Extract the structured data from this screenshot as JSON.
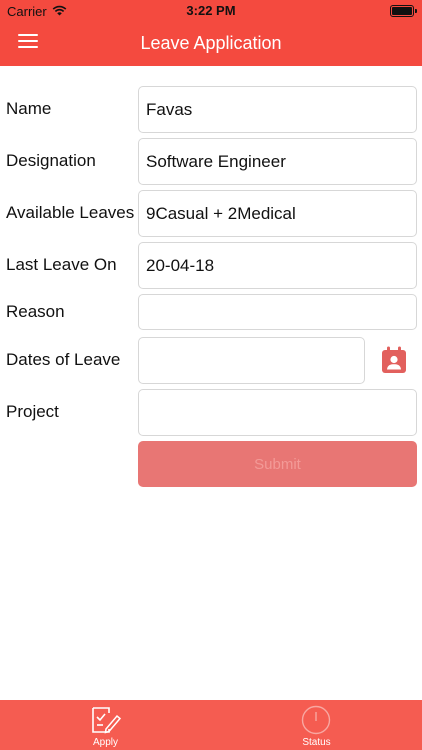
{
  "status_bar": {
    "carrier": "Carrier",
    "time": "3:22 PM"
  },
  "header": {
    "title": "Leave Application",
    "menu_icon": "hamburger-menu-icon"
  },
  "form": {
    "name": {
      "label": "Name",
      "value": "Favas"
    },
    "designation": {
      "label": "Designation",
      "value": "Software Engineer"
    },
    "available_leaves": {
      "label": "Available Leaves",
      "value": "9Casual + 2Medical"
    },
    "last_leave_on": {
      "label": "Last Leave On",
      "value": "20-04-18"
    },
    "reason": {
      "label": "Reason",
      "value": ""
    },
    "dates_of_leave": {
      "label": "Dates of Leave",
      "value": "",
      "icon": "calendar-person-icon"
    },
    "project": {
      "label": "Project",
      "value": ""
    },
    "submit_label": "Submit"
  },
  "tabbar": {
    "tabs": [
      {
        "label": "Apply",
        "icon": "apply-form-icon"
      },
      {
        "label": "Status",
        "icon": "status-clock-icon"
      }
    ]
  },
  "colors": {
    "header": "#f44a3f",
    "tabbar": "#f55c51",
    "submit_disabled": "#e87674",
    "calendar_icon": "#e2605d"
  }
}
